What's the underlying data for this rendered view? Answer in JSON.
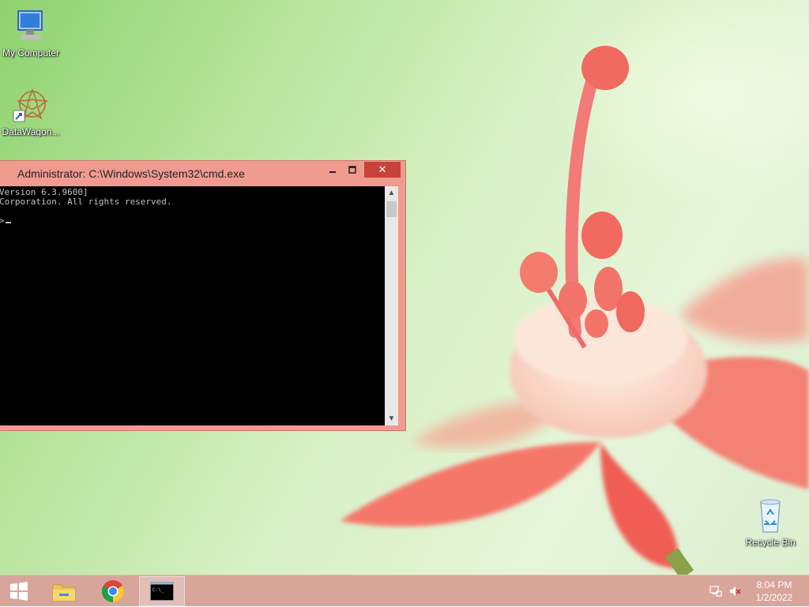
{
  "desktop": {
    "icons": [
      {
        "label": "My Computer",
        "icon": "computer-icon"
      },
      {
        "label": "DataWagon...",
        "icon": "datawagon-icon"
      },
      {
        "label": "Recycle Bin",
        "icon": "recycle-bin-icon"
      }
    ]
  },
  "cmd_window": {
    "title": "Administrator: C:\\Windows\\System32\\cmd.exe",
    "lines": [
      "Version 6.3.9600]",
      "Corporation. All rights reserved.",
      "",
      ">"
    ],
    "close_label": "✕",
    "scroll_up": "▲",
    "scroll_down": "▼"
  },
  "taskbar": {
    "items": [
      {
        "name": "start",
        "icon": "windows-logo-icon"
      },
      {
        "name": "file-explorer",
        "icon": "folder-icon"
      },
      {
        "name": "chrome",
        "icon": "chrome-icon"
      },
      {
        "name": "command-prompt",
        "icon": "cmd-icon",
        "active": true
      }
    ],
    "clock": {
      "time": "8:04 PM",
      "date": "1/2/2022"
    },
    "tray": [
      "network-icon",
      "volume-muted-icon"
    ]
  },
  "colors": {
    "window_frame": "#f19a90",
    "close_button": "#c7433a",
    "taskbar": "#d8a59b"
  }
}
